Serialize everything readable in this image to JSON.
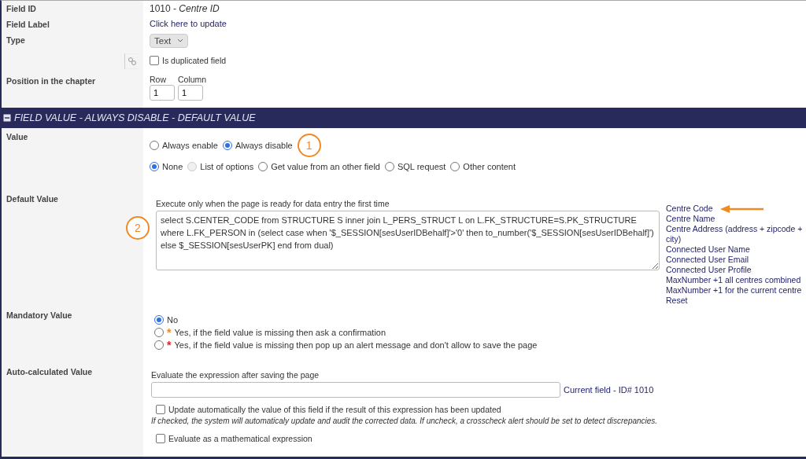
{
  "field_id": {
    "label": "Field ID",
    "value": "1010 - *Centre ID*"
  },
  "field_label": {
    "label": "Field Label",
    "link": "Click here to update"
  },
  "type": {
    "label": "Type",
    "value": "Text"
  },
  "duplicate": {
    "label": "Is duplicated field",
    "checked": false
  },
  "position": {
    "label": "Position in the chapter",
    "row_label": "Row",
    "row_value": "1",
    "column_label": "Column",
    "column_value": "1"
  },
  "section_header": {
    "title": "FIELD VALUE - ALWAYS DISABLE - DEFAULT VALUE",
    "expanded": true
  },
  "value": {
    "label": "Value",
    "callout": "1",
    "mode_options": [
      {
        "label": "Always enable",
        "selected": false
      },
      {
        "label": "Always disable",
        "selected": true
      }
    ],
    "source_options": [
      {
        "label": "None",
        "selected": true,
        "disabled": false
      },
      {
        "label": "List of options",
        "selected": false,
        "disabled": true
      },
      {
        "label": "Get value from an other field",
        "selected": false,
        "disabled": false
      },
      {
        "label": "SQL request",
        "selected": false,
        "disabled": false
      },
      {
        "label": "Other content",
        "selected": false,
        "disabled": false
      }
    ]
  },
  "default_value": {
    "label": "Default Value",
    "callout": "2",
    "hint": "Execute only when the page is ready for data entry the first time",
    "sql": "select S.CENTER_CODE from STRUCTURE S inner join L_PERS_STRUCT L on L.FK_STRUCTURE=S.PK_STRUCTURE where L.FK_PERSON in (select case when '$_SESSION[sesUserIDBehalf]'>'0' then to_number('$_SESSION[sesUserIDBehalf]') else $_SESSION[sesUserPK] end from dual)",
    "shortcuts": [
      {
        "label": "Centre Code",
        "pointed": true
      },
      {
        "label": "Centre Name",
        "pointed": false
      },
      {
        "label": "Centre Address (address + zipcode + city)",
        "pointed": false
      },
      {
        "label": "Connected User Name",
        "pointed": false
      },
      {
        "label": "Connected User Email",
        "pointed": false
      },
      {
        "label": "Connected User Profile",
        "pointed": false
      },
      {
        "label": "MaxNumber +1 all centres combined",
        "pointed": false
      },
      {
        "label": "MaxNumber +1 for the current centre",
        "pointed": false
      },
      {
        "label": "Reset",
        "pointed": false
      }
    ]
  },
  "mandatory": {
    "label": "Mandatory Value",
    "options": [
      {
        "label": "No",
        "selected": true
      },
      {
        "label": "Yes, if the field value is missing then ask a confirmation",
        "selected": false,
        "asterisk": "*",
        "color": "#f08a24"
      },
      {
        "label": "Yes, if the field value is missing then pop up an alert message and don't allow to save the page",
        "selected": false,
        "asterisk": "*",
        "color": "#d9262c"
      }
    ]
  },
  "auto_calc": {
    "label": "Auto-calculated Value",
    "hint": "Evaluate the expression after saving the page",
    "current_field": "Current field - ID# 1010",
    "update": {
      "label": "Update automatically the value of this field if the result of this expression has been updated",
      "checked": false
    },
    "note": "If checked, the system will automaticaly update and audit the corrected data. If uncheck, a crosscheck alert should be set to detect discrepancies.",
    "math": {
      "label": "Evaluate as a mathematical expression",
      "checked": false
    }
  }
}
